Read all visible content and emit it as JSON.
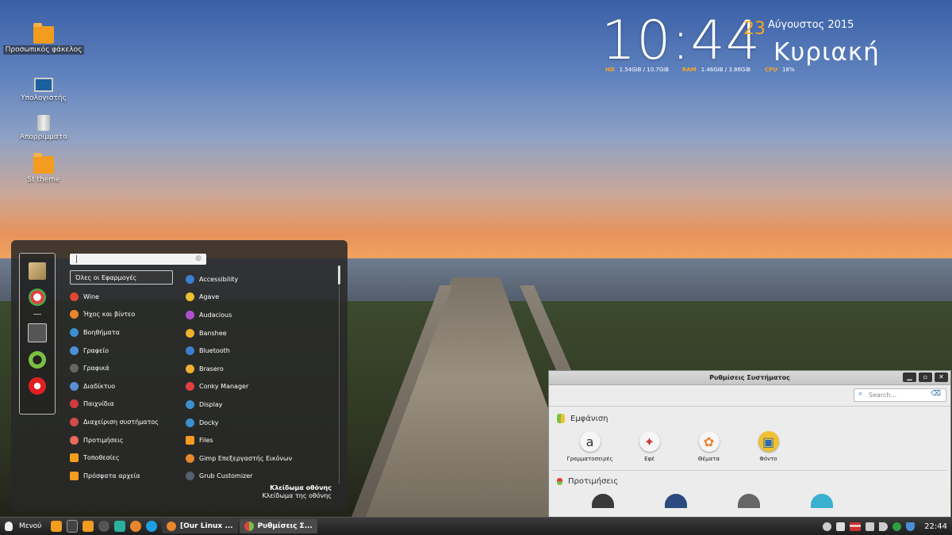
{
  "desktop": {
    "icons": [
      {
        "label": "Προσωπικός φάκελος"
      },
      {
        "label": "Υπολογιστής"
      },
      {
        "label": "Απορρίμματα"
      },
      {
        "label": "St theme"
      }
    ]
  },
  "conky": {
    "time": "10:44",
    "day": "23",
    "month_year": "Αύγουστος 2015",
    "weekday": "Κυριακή",
    "hd_label": "HD",
    "hd_value": "1.54GiB / 10.7GiB",
    "ram_label": "RAM",
    "ram_value": "1.46GiB / 3.86GiB",
    "cpu_label": "CPU",
    "cpu_value": "18%"
  },
  "menu": {
    "categories": [
      {
        "label": "Όλες οι Εφαρμογές",
        "color": "transparent"
      },
      {
        "label": "Wine",
        "color": "#e0472f"
      },
      {
        "label": "Ήχος και βίντεο",
        "color": "#e8862e"
      },
      {
        "label": "Βοηθήματα",
        "color": "#3a8fd0"
      },
      {
        "label": "Γραφείο",
        "color": "#4a90d9"
      },
      {
        "label": "Γραφικά",
        "color": "#555555"
      },
      {
        "label": "Διαδίκτυο",
        "color": "#5a8fd6"
      },
      {
        "label": "Παιχνίδια",
        "color": "#d23b3b"
      },
      {
        "label": "Διαχείριση συστήματος",
        "color": "#d44a4a"
      },
      {
        "label": "Προτιμήσεις",
        "color": "#e86a5a"
      },
      {
        "label": "Τοποθεσίες",
        "color": "#f39c1f"
      },
      {
        "label": "Πρόσφατα αρχεία",
        "color": "#f39c1f"
      }
    ],
    "apps": [
      {
        "label": "Accessibility",
        "color": "#3a7fd0"
      },
      {
        "label": "Agave",
        "color": "#f0c030"
      },
      {
        "label": "Audacious",
        "color": "#b050d0"
      },
      {
        "label": "Banshee",
        "color": "#f0b030"
      },
      {
        "label": "Bluetooth",
        "color": "#3a7fd0"
      },
      {
        "label": "Brasero",
        "color": "#f0b030"
      },
      {
        "label": "Conky Manager",
        "color": "#e04040"
      },
      {
        "label": "Display",
        "color": "#3a8fd0"
      },
      {
        "label": "Docky",
        "color": "#3a8fd0"
      },
      {
        "label": "Files",
        "color": "#f39c1f"
      },
      {
        "label": "Gimp Επεξεργαστής Εικόνων",
        "color": "#e8862e"
      },
      {
        "label": "Grub Customizer",
        "color": "#556070"
      }
    ],
    "lock_title": "Κλείδωμα οθόνης",
    "lock_desc": "Κλείδωμα της οθόνης"
  },
  "settings": {
    "title": "Ρυθμίσεις Συστήματος",
    "search_placeholder": "Search...",
    "appearance_header": "Εμφάνιση",
    "appearance_items": [
      {
        "label": "Γραμματοσειρές",
        "glyph": "a"
      },
      {
        "label": "Εφέ",
        "glyph": "✦"
      },
      {
        "label": "Θέματα",
        "glyph": "✿"
      },
      {
        "label": "Φόντο",
        "glyph": "▣"
      }
    ],
    "prefs_header": "Προτιμήσεις"
  },
  "panel": {
    "menu_label": "Μενού",
    "tasks": [
      {
        "label": "[Our Linux ..."
      },
      {
        "label": "Ρυθμίσεις Σ..."
      }
    ],
    "clock": "22:44"
  }
}
